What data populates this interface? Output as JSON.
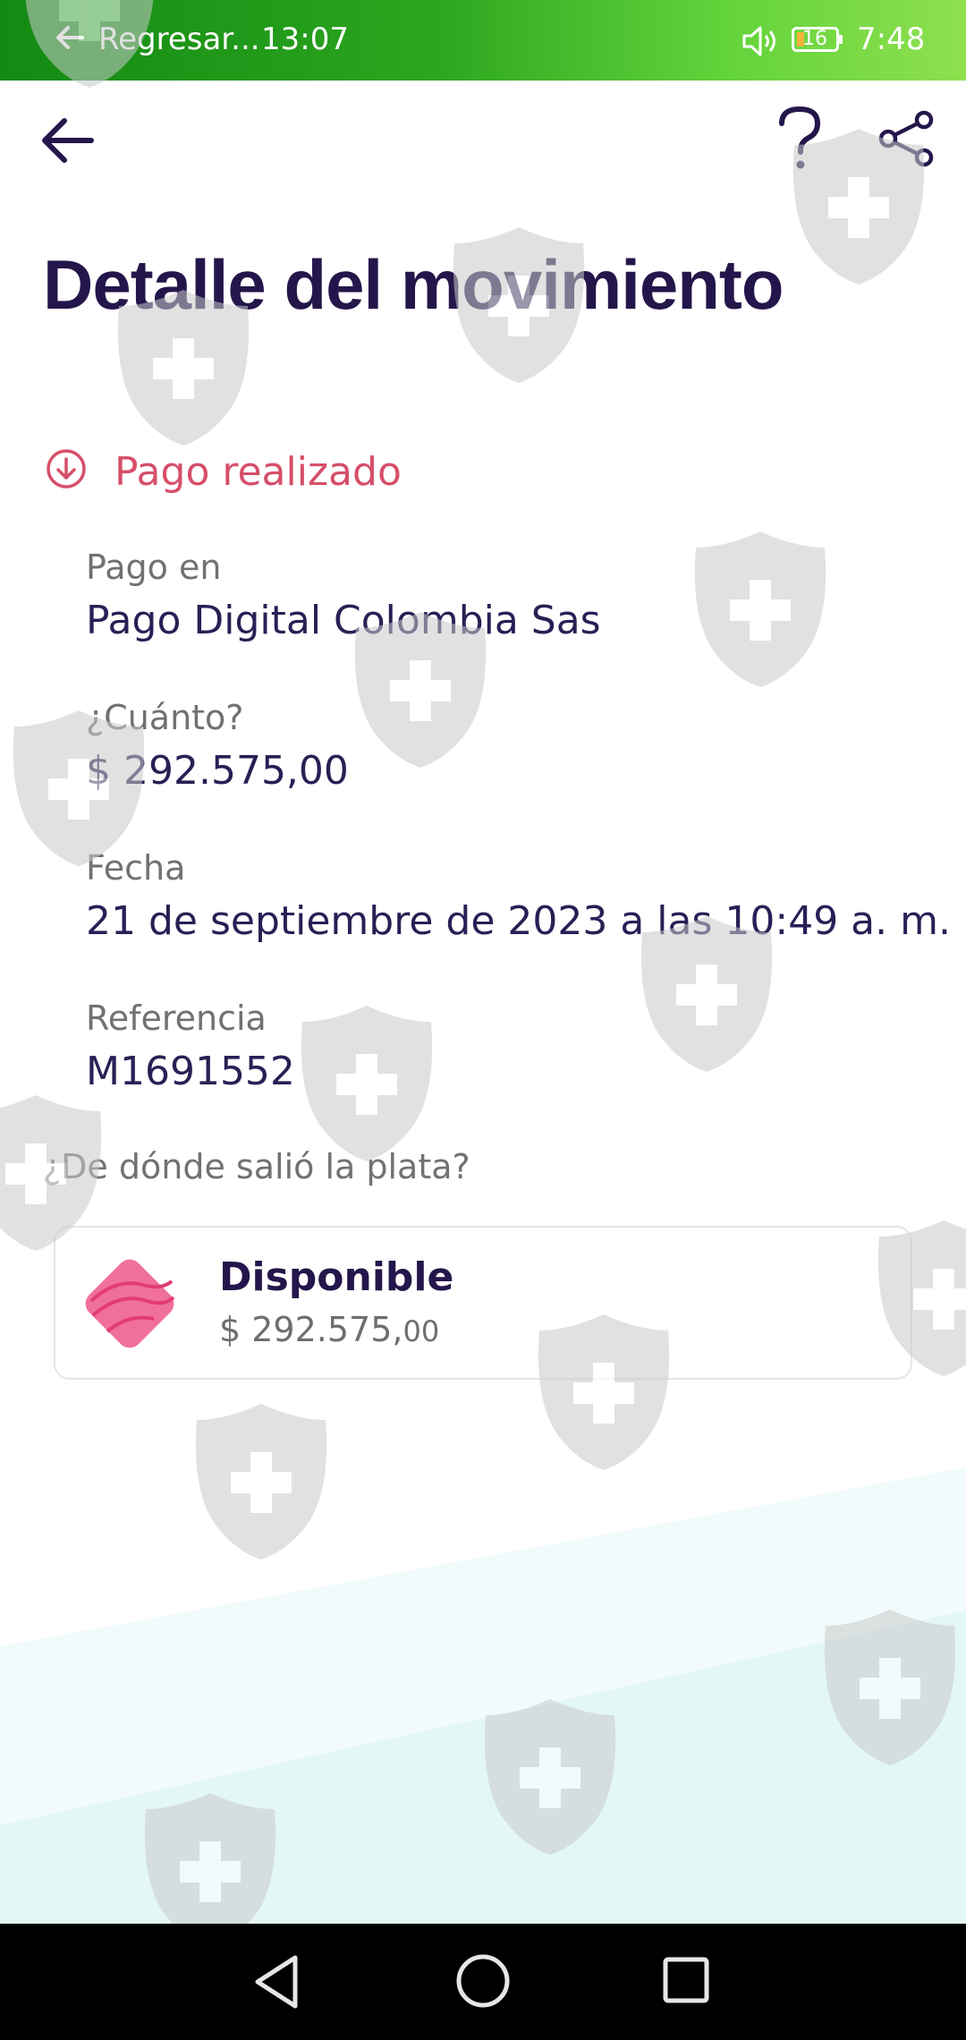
{
  "status_bar": {
    "back_label": "Regresar...",
    "time_left": "13:07",
    "battery": "16",
    "time_right": "7:48",
    "icons": [
      "back-arrow-icon",
      "volume-icon",
      "battery-icon"
    ]
  },
  "header": {
    "title": "Detalle del movimiento",
    "icons": [
      "back-arrow-icon",
      "help-icon",
      "share-icon"
    ]
  },
  "status": {
    "label": "Pago realizado",
    "icon": "download-circle-icon",
    "color": "#d64f6a"
  },
  "details": [
    {
      "label": "Pago en",
      "value": "Pago Digital Colombia Sas"
    },
    {
      "label": "¿Cuánto?",
      "value": "$ 292.575,00"
    },
    {
      "label": "Fecha",
      "value": "21 de septiembre de 2023 a las 10:49 a. m."
    },
    {
      "label": "Referencia",
      "value": "M1691552"
    }
  ],
  "source": {
    "question": "¿De dónde salió la plata?",
    "name": "Disponible",
    "amount_main": "$ 292.575,",
    "amount_cents": "00",
    "icon": "pocket-icon"
  },
  "colors": {
    "title": "#24164a",
    "accent_pink": "#f0709a",
    "status_bar_green": "#2ca51f"
  },
  "system_nav": [
    "back-triangle-icon",
    "home-circle-icon",
    "recents-square-icon"
  ]
}
